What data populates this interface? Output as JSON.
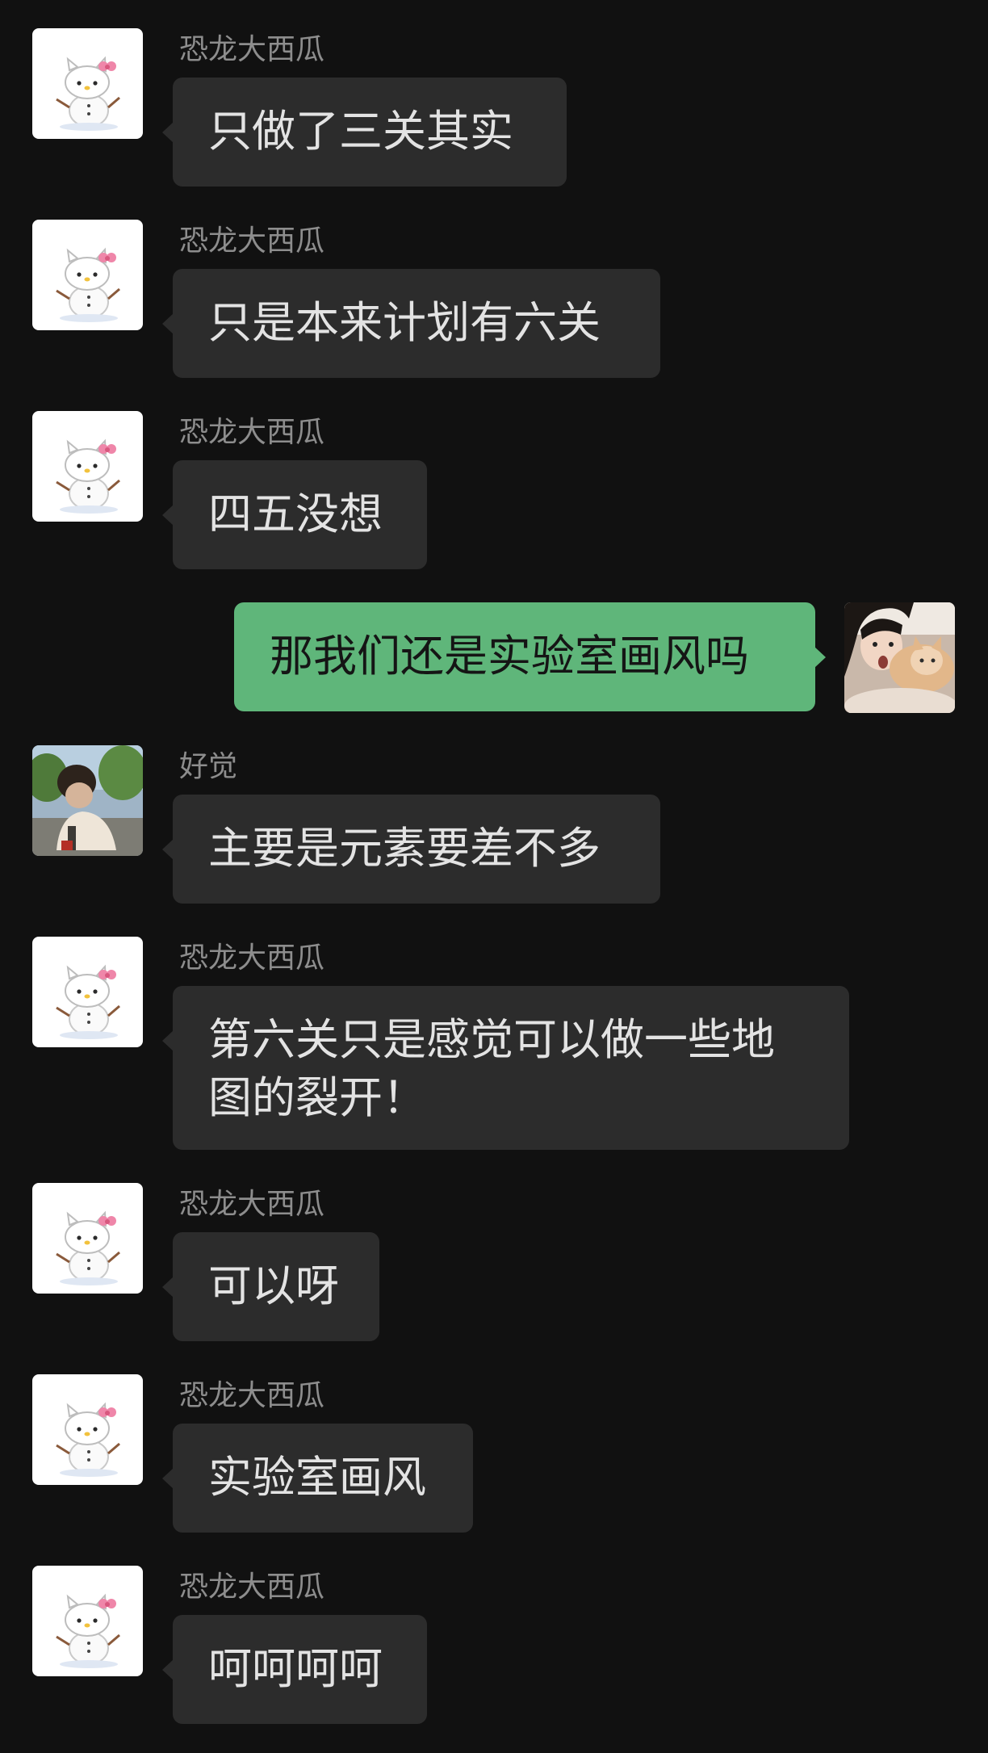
{
  "colors": {
    "background": "#111111",
    "incoming_bubble": "#2c2c2c",
    "outgoing_bubble": "#5fb67a",
    "sender_name": "#8d8d8d",
    "incoming_text": "#e3e3e3",
    "outgoing_text": "#151515"
  },
  "messages": [
    {
      "direction": "incoming",
      "sender": "恐龙大西瓜",
      "avatar": "hello-kitty-snowman-avatar",
      "text": "只做了三关其实"
    },
    {
      "direction": "incoming",
      "sender": "恐龙大西瓜",
      "avatar": "hello-kitty-snowman-avatar",
      "text": "只是本来计划有六关"
    },
    {
      "direction": "incoming",
      "sender": "恐龙大西瓜",
      "avatar": "hello-kitty-snowman-avatar",
      "text": "四五没想"
    },
    {
      "direction": "outgoing",
      "avatar": "girl-with-cat-avatar",
      "text": "那我们还是实验室画风吗"
    },
    {
      "direction": "incoming",
      "sender": "好觉",
      "avatar": "outdoor-photo-avatar",
      "text": "主要是元素要差不多"
    },
    {
      "direction": "incoming",
      "sender": "恐龙大西瓜",
      "avatar": "hello-kitty-snowman-avatar",
      "text_lines": [
        "第六关只是感觉可以做一些地",
        "图的裂开！"
      ]
    },
    {
      "direction": "incoming",
      "sender": "恐龙大西瓜",
      "avatar": "hello-kitty-snowman-avatar",
      "text": "可以呀"
    },
    {
      "direction": "incoming",
      "sender": "恐龙大西瓜",
      "avatar": "hello-kitty-snowman-avatar",
      "text": "实验室画风"
    },
    {
      "direction": "incoming",
      "sender": "恐龙大西瓜",
      "avatar": "hello-kitty-snowman-avatar",
      "text": "呵呵呵呵"
    }
  ]
}
